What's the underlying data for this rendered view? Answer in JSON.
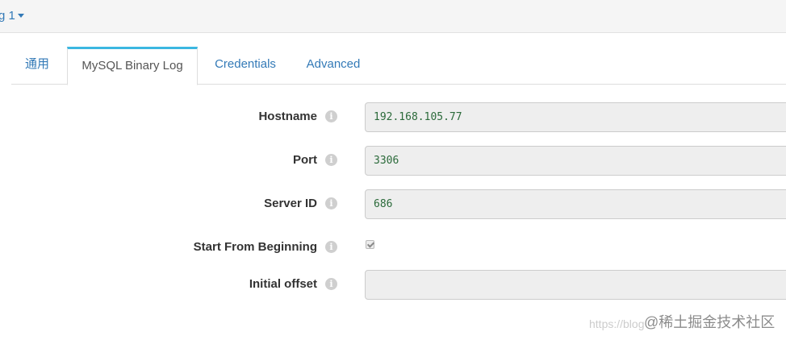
{
  "header": {
    "title": "g 1"
  },
  "tabs": [
    {
      "label": "通用",
      "active": false
    },
    {
      "label": "MySQL Binary Log",
      "active": true
    },
    {
      "label": "Credentials",
      "active": false
    },
    {
      "label": "Advanced",
      "active": false
    }
  ],
  "form": {
    "hostname": {
      "label": "Hostname",
      "value": "192.168.105.77"
    },
    "port": {
      "label": "Port",
      "value": "3306"
    },
    "server_id": {
      "label": "Server ID",
      "value": "686"
    },
    "start_from_beginning": {
      "label": "Start From Beginning",
      "checked": true
    },
    "initial_offset": {
      "label": "Initial offset",
      "value": ""
    }
  },
  "icons": {
    "info": "info-icon",
    "caret": "caret-down-icon"
  },
  "colors": {
    "link": "#337ab7",
    "active_tab_accent": "#3bb7e1",
    "input_bg": "#eeeeee",
    "input_text": "#2b6a3a"
  },
  "watermark": {
    "url": "https://blog",
    "brand": "@稀土掘金技术社区"
  }
}
